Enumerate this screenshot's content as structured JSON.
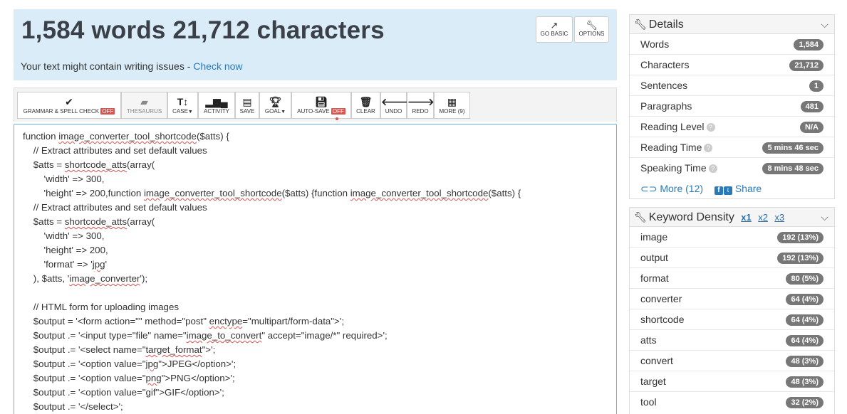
{
  "header": {
    "title": "1,584 words 21,712 characters",
    "issues_text": "Your text might contain writing issues - ",
    "issues_link": "Check now",
    "go_basic": "GO BASIC",
    "options": "OPTIONS"
  },
  "toolbar": {
    "grammar": "GRAMMAR & SPELL CHECK",
    "grammar_state": "OFF",
    "thesaurus": "THESAURUS",
    "case": "CASE",
    "activity": "ACTIVITY",
    "save": "SAVE",
    "goal": "GOAL",
    "autosave": "AUTO-SAVE",
    "autosave_state": "OFF",
    "clear": "CLEAR",
    "undo": "UNDO",
    "redo": "REDO",
    "more": "MORE (9)"
  },
  "editor_lines": [
    "function image_converter_tool_shortcode($atts) {",
    "    // Extract attributes and set default values",
    "    $atts = shortcode_atts(array(",
    "        'width' => 300,",
    "        'height' => 200,function image_converter_tool_shortcode($atts) {function image_converter_tool_shortcode($atts) {",
    "    // Extract attributes and set default values",
    "    $atts = shortcode_atts(array(",
    "        'width' => 300,",
    "        'height' => 200,",
    "        'format' => 'jpg'",
    "    ), $atts, 'image_converter');",
    "",
    "    // HTML form for uploading images",
    "    $output = '<form action=\"\" method=\"post\" enctype=\"multipart/form-data\">';",
    "    $output .= '<input type=\"file\" name=\"image_to_convert\" accept=\"image/*\" required>';",
    "    $output .= '<select name=\"target_format\">';",
    "    $output .= '<option value=\"jpg\">JPEG</option>';",
    "    $output .= '<option value=\"png\">PNG</option>';",
    "    $output .= '<option value=\"gif\">GIF</option>';",
    "    $output .= '</select>';"
  ],
  "details": {
    "title": "Details",
    "rows": [
      {
        "label": "Words",
        "value": "1,584"
      },
      {
        "label": "Characters",
        "value": "21,712"
      },
      {
        "label": "Sentences",
        "value": "1"
      },
      {
        "label": "Paragraphs",
        "value": "481"
      },
      {
        "label": "Reading Level",
        "value": "N/A"
      },
      {
        "label": "Reading Time",
        "value": "5 mins 46 sec"
      },
      {
        "label": "Speaking Time",
        "value": "8 mins 48 sec"
      }
    ],
    "more": "More (12)",
    "share": "Share"
  },
  "keyword_density": {
    "title": "Keyword Density",
    "x1": "x1",
    "x2": "x2",
    "x3": "x3",
    "rows": [
      {
        "label": "image",
        "value": "192 (13%)"
      },
      {
        "label": "output",
        "value": "192 (13%)"
      },
      {
        "label": "format",
        "value": "80 (5%)"
      },
      {
        "label": "converter",
        "value": "64 (4%)"
      },
      {
        "label": "shortcode",
        "value": "64 (4%)"
      },
      {
        "label": "atts",
        "value": "64 (4%)"
      },
      {
        "label": "convert",
        "value": "48 (3%)"
      },
      {
        "label": "target",
        "value": "48 (3%)"
      },
      {
        "label": "tool",
        "value": "32 (2%)"
      }
    ]
  }
}
